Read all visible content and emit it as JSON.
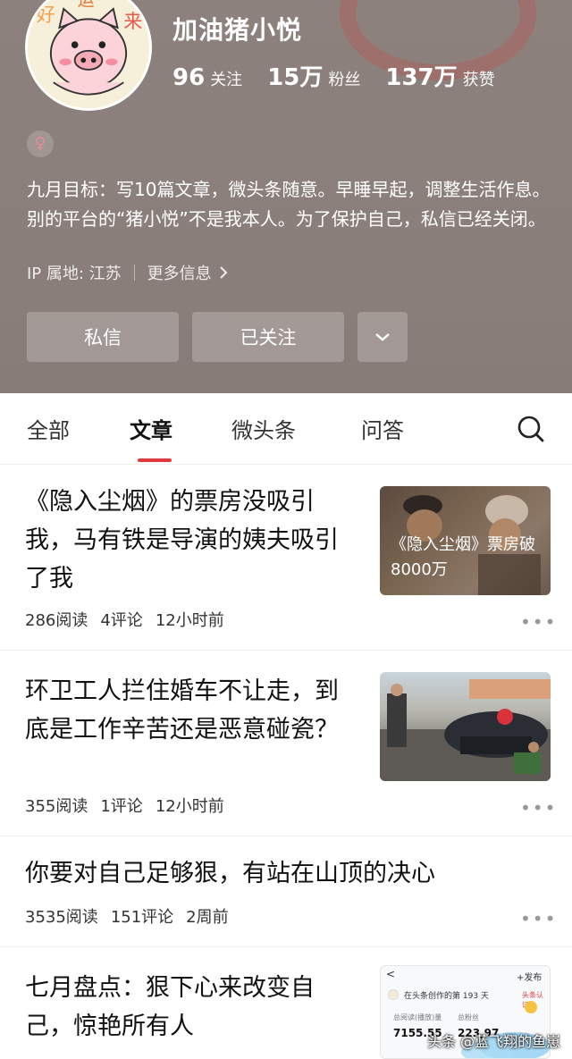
{
  "profile": {
    "name": "加油猪小悦",
    "stats": [
      {
        "num": "96",
        "label": "关注"
      },
      {
        "num": "15万",
        "label": "粉丝"
      },
      {
        "num": "137万",
        "label": "获赞"
      }
    ],
    "gender_symbol": "♀",
    "bio": "九月目标：写10篇文章，微头条随意。早睡早起，调整生活作息。别的平台的“猪小悦”不是我本人。为了保护自己，私信已经关闭。",
    "ip": "IP 属地: 江苏",
    "more_info": "更多信息",
    "buttons": {
      "message": "私信",
      "followed": "已关注"
    },
    "avatar_text": [
      "好",
      "运",
      "来"
    ]
  },
  "tabs": [
    {
      "label": "全部",
      "active": false
    },
    {
      "label": "文章",
      "active": true
    },
    {
      "label": "微头条",
      "active": false
    },
    {
      "label": "问答",
      "active": false
    }
  ],
  "articles": [
    {
      "title": "《隐入尘烟》的票房没吸引我，马有铁是导演的姨夫吸引了我",
      "reads": "286阅读",
      "comments": "4评论",
      "time": "12小时前",
      "thumb_caption": "《隐入尘烟》票房破8000万"
    },
    {
      "title": "环卫工人拦住婚车不让走，到底是工作辛苦还是恶意碰瓷？",
      "reads": "355阅读",
      "comments": "1评论",
      "time": "12小时前"
    },
    {
      "title": "你要对自己足够狠，有站在山顶的决心",
      "reads": "3535阅读",
      "comments": "151评论",
      "time": "2周前"
    },
    {
      "title": "七月盘点：狠下心来改变自己，惊艳所有人",
      "thumb_text": {
        "back": "<",
        "publish": "+发布",
        "day": "在头条创作的第 193 天",
        "badge": "头条认证",
        "reads_label": "总阅读(播放)量",
        "fans_label": "总粉丝",
        "reads_value": "7155.55",
        "fans_value": "223,97"
      }
    }
  ],
  "watermark": "头条 @蓝飞翔的鱼崽"
}
